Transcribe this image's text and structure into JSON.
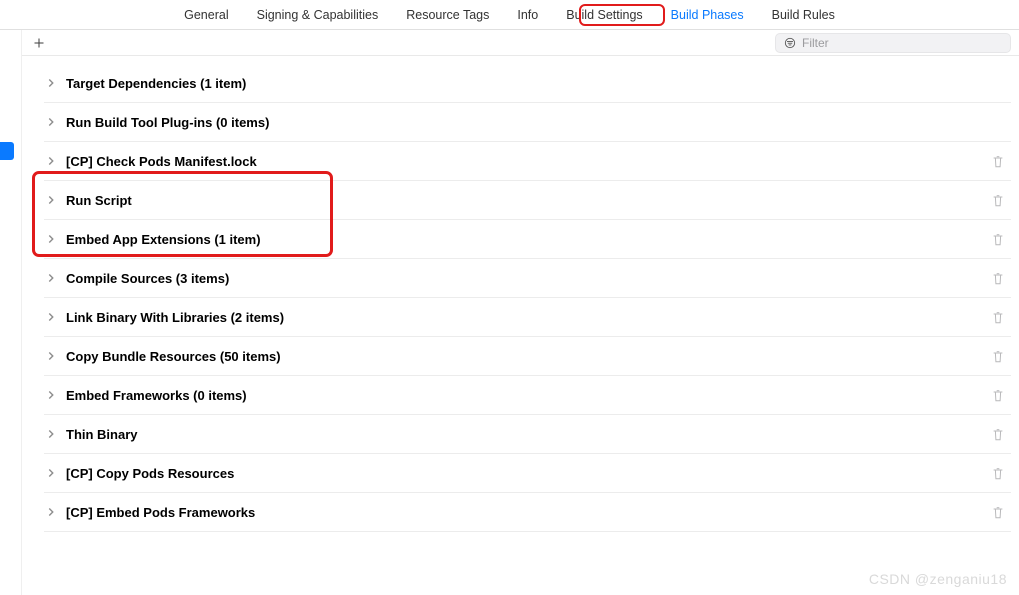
{
  "tabs": [
    {
      "label": "General"
    },
    {
      "label": "Signing & Capabilities"
    },
    {
      "label": "Resource Tags"
    },
    {
      "label": "Info"
    },
    {
      "label": "Build Settings"
    },
    {
      "label": "Build Phases",
      "active": true
    },
    {
      "label": "Build Rules"
    }
  ],
  "filter": {
    "placeholder": "Filter"
  },
  "phases": [
    {
      "label": "Target Dependencies (1 item)",
      "deletable": false
    },
    {
      "label": "Run Build Tool Plug-ins (0 items)",
      "deletable": false
    },
    {
      "label": "[CP] Check Pods Manifest.lock",
      "deletable": true
    },
    {
      "label": "Run Script",
      "deletable": true
    },
    {
      "label": "Embed App Extensions (1 item)",
      "deletable": true
    },
    {
      "label": "Compile Sources (3 items)",
      "deletable": true
    },
    {
      "label": "Link Binary With Libraries (2 items)",
      "deletable": true
    },
    {
      "label": "Copy Bundle Resources (50 items)",
      "deletable": true
    },
    {
      "label": "Embed Frameworks (0 items)",
      "deletable": true
    },
    {
      "label": "Thin Binary",
      "deletable": true
    },
    {
      "label": "[CP] Copy Pods Resources",
      "deletable": true
    },
    {
      "label": "[CP] Embed Pods Frameworks",
      "deletable": true
    }
  ],
  "watermark": "CSDN @zenganiu18"
}
